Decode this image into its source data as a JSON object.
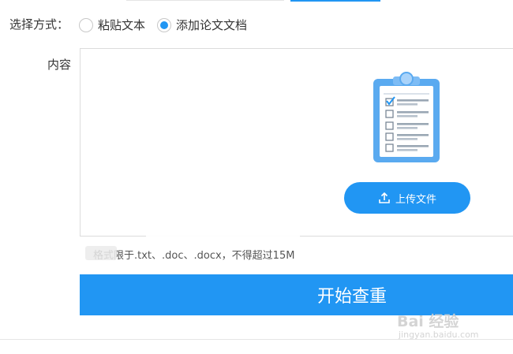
{
  "form": {
    "mode_label": "选择方式：",
    "mode_options": [
      {
        "label": "粘贴文本",
        "selected": false
      },
      {
        "label": "添加论文文档",
        "selected": true
      }
    ],
    "content_label": "内容"
  },
  "upload": {
    "button_label": "上传文件",
    "hint": "格式限于.txt、.doc、.docx，不得超过15M"
  },
  "actions": {
    "start_label": "开始查重"
  },
  "watermark": {
    "logo": "Bai 经验",
    "url": "jingyan.baidu.com"
  },
  "colors": {
    "accent": "#2196f3",
    "border": "#dcdcdc",
    "clipboard_body": "#5aaaf0",
    "clipboard_paper": "#ffffff"
  },
  "icons": [
    "clipboard-checklist-icon",
    "upload-icon",
    "radio-button",
    "paw-icon"
  ]
}
